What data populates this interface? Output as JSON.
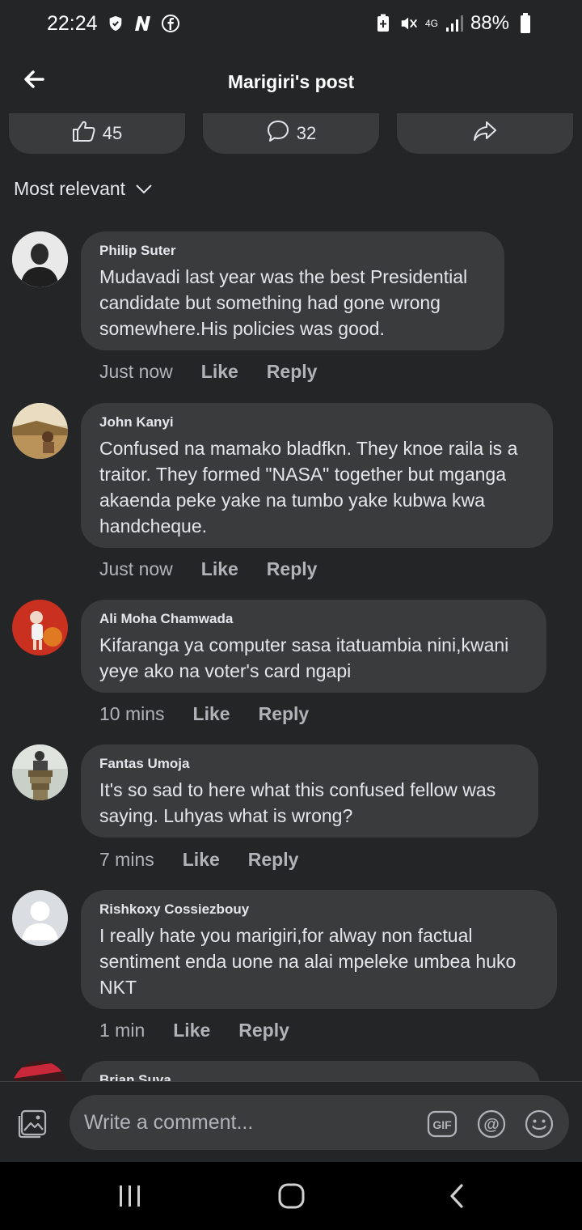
{
  "status_bar": {
    "time": "22:24",
    "network": "4G",
    "battery": "88%"
  },
  "header": {
    "title": "Marigiri's post"
  },
  "actions": {
    "likes": "45",
    "comments": "32"
  },
  "sort": {
    "label": "Most relevant"
  },
  "comments": [
    {
      "name": "Philip Suter",
      "text": "Mudavadi last year was the best Presidential candidate but something had gone wrong somewhere.His policies was good.",
      "time": "Just now",
      "like": "Like",
      "reply": "Reply"
    },
    {
      "name": "John Kanyi",
      "text": "Confused na mamako bladfkn. They knoe raila is a traitor. They formed \"NASA\" together but mganga akaenda peke yake na tumbo yake kubwa kwa handcheque.",
      "time": "Just now",
      "like": "Like",
      "reply": "Reply"
    },
    {
      "name": "Ali Moha Chamwada",
      "text": "Kifaranga ya computer sasa itatuambia nini,kwani yeye ako na voter's card ngapi",
      "time": "10 mins",
      "like": "Like",
      "reply": "Reply"
    },
    {
      "name": "Fantas Umoja",
      "text": "It's so sad to here what this confused fellow was saying. Luhyas what is wrong?",
      "time": "7 mins",
      "like": "Like",
      "reply": "Reply"
    },
    {
      "name": "Rishkoxy Cossiezbouy",
      "text": "I really  hate  you marigiri,for alway non factual sentiment  enda uone na alai mpeleke umbea huko NKT",
      "time": "1 min",
      "like": "Like",
      "reply": "Reply"
    },
    {
      "name": "Brian Suva"
    }
  ],
  "composer": {
    "placeholder": "Write a comment..."
  },
  "colors": {
    "background": "#242526",
    "bubble": "#3a3b3c",
    "text": "#e4e6eb",
    "secondary_text": "#b0b3b8",
    "navbar": "#000000"
  }
}
